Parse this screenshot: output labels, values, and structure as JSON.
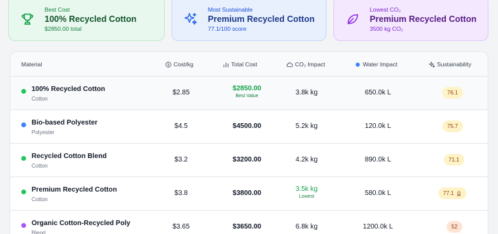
{
  "cards": [
    {
      "label": "Best Cost",
      "title": "100% Recycled Cotton",
      "sub": "$2850.00 total",
      "icon": "trophy-icon"
    },
    {
      "label": "Most Sustainable",
      "title": "Premium Recycled Cotton",
      "sub": "77.1/100 score",
      "icon": "sparkles-icon"
    },
    {
      "label": "Lowest CO₂",
      "title": "Premium Recycled Cotton",
      "sub": "3500 kg CO₂",
      "icon": "leaf-icon"
    }
  ],
  "table": {
    "headers": {
      "material": "Material",
      "cost": "Cost/kg",
      "total": "Total Cost",
      "co2": "CO₂ Impact",
      "water": "Water Impact",
      "sustainability": "Sustainability"
    },
    "rows": [
      {
        "name": "100% Recycled Cotton",
        "type": "Cotton",
        "dot": "#22c55e",
        "cost": "$2.85",
        "total": "$2850.00",
        "total_note": "Best Value",
        "co2": "3.8k kg",
        "co2_note": "",
        "water": "650.0k L",
        "score": "76.1"
      },
      {
        "name": "Bio-based Polyester",
        "type": "Polyester",
        "dot": "#3b82f6",
        "cost": "$4.5",
        "total": "$4500.00",
        "total_note": "",
        "co2": "5.2k kg",
        "co2_note": "",
        "water": "120.0k L",
        "score": "75.7"
      },
      {
        "name": "Recycled Cotton Blend",
        "type": "Cotton",
        "dot": "#22c55e",
        "cost": "$3.2",
        "total": "$3200.00",
        "total_note": "",
        "co2": "4.2k kg",
        "co2_note": "",
        "water": "890.0k L",
        "score": "71.1"
      },
      {
        "name": "Premium Recycled Cotton",
        "type": "Cotton",
        "dot": "#22c55e",
        "cost": "$3.8",
        "total": "$3800.00",
        "total_note": "",
        "co2": "3.5k kg",
        "co2_note": "Lowest",
        "water": "580.0k L",
        "score": "77.1"
      },
      {
        "name": "Organic Cotton-Recycled Poly",
        "type": "Blend",
        "dot": "#a855f7",
        "cost": "$3.65",
        "total": "$3650.00",
        "total_note": "",
        "co2": "6.8k kg",
        "co2_note": "",
        "water": "1200.0k L",
        "score": "52"
      }
    ]
  },
  "colors": {
    "best": "#16a34a",
    "accent_blue": "#2563eb",
    "accent_purple": "#7e22ce"
  }
}
